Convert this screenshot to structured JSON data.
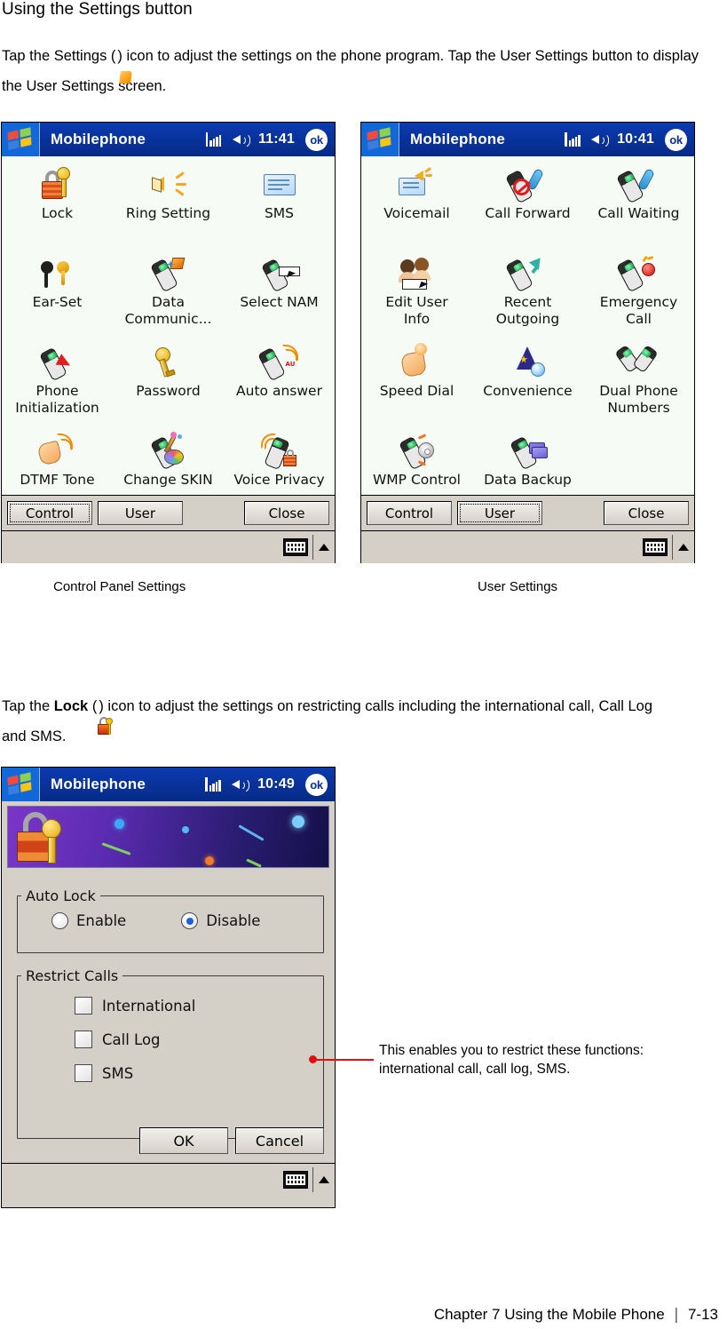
{
  "page": {
    "heading": "Using the Settings button",
    "intro_prefix": "Tap the Settings (",
    "intro_suffix": ") icon to adjust the settings on the phone program. Tap the User Settings button to display the User Settings screen.",
    "lock_prefix": "Tap the ",
    "lock_bold": "Lock",
    "lock_paren_open": " (",
    "lock_suffix": ") icon to adjust the settings on restricting calls including the international call, Call Log and SMS.",
    "footer_chapter": "Chapter 7 Using the Mobile Phone",
    "footer_separator": "❘",
    "footer_page": "7-13"
  },
  "captions": {
    "control": "Control Panel Settings",
    "user": "User Settings"
  },
  "device_control": {
    "titlebar": {
      "app_title": "Mobilephone",
      "clock": "11:41",
      "ok_label": "ok",
      "signal_icon": "signal-bars-icon",
      "speaker_icon": "speaker-volume-icon",
      "logo_icon": "windows-start-icon"
    },
    "icons": [
      {
        "label": "Lock",
        "glyph": "padlock-key-icon"
      },
      {
        "label": "Ring Setting",
        "glyph": "speaker-ring-icon"
      },
      {
        "label": "SMS",
        "glyph": "envelope-icon"
      },
      {
        "label": "Ear-Set",
        "glyph": "earset-icon"
      },
      {
        "label": "Data\nCommunic...",
        "glyph": "phone-data-icon"
      },
      {
        "label": "Select NAM",
        "glyph": "phone-select-icon"
      },
      {
        "label": "Phone\nInitialization",
        "glyph": "phone-init-icon"
      },
      {
        "label": "Password",
        "glyph": "key-icon"
      },
      {
        "label": "Auto answer",
        "glyph": "phone-auto-answer-icon"
      },
      {
        "label": "DTMF Tone",
        "glyph": "hand-tone-icon"
      },
      {
        "label": "Change SKIN",
        "glyph": "phone-skin-icon"
      },
      {
        "label": "Voice Privacy",
        "glyph": "phone-privacy-icon"
      }
    ],
    "buttons": {
      "control": "Control",
      "user": "User",
      "close": "Close",
      "focused": "Control"
    },
    "taskbar": {
      "keyboard_icon": "soft-keyboard-icon",
      "caret_icon": "caret-up-icon"
    }
  },
  "device_user": {
    "titlebar": {
      "app_title": "Mobilephone",
      "clock": "10:41",
      "ok_label": "ok",
      "signal_icon": "signal-bars-icon",
      "speaker_icon": "speaker-volume-icon",
      "logo_icon": "windows-start-icon"
    },
    "icons": [
      {
        "label": "Voicemail",
        "glyph": "voicemail-icon"
      },
      {
        "label": "Call Forward",
        "glyph": "call-forward-icon"
      },
      {
        "label": "Call Waiting",
        "glyph": "call-waiting-icon"
      },
      {
        "label": "Edit User\nInfo",
        "glyph": "edit-user-info-icon"
      },
      {
        "label": "Recent\nOutgoing",
        "glyph": "recent-outgoing-icon"
      },
      {
        "label": "Emergency\nCall",
        "glyph": "emergency-call-icon"
      },
      {
        "label": "Speed Dial",
        "glyph": "speed-dial-icon"
      },
      {
        "label": "Convenience",
        "glyph": "convenience-wizard-icon"
      },
      {
        "label": "Dual Phone\nNumbers",
        "glyph": "dual-phone-numbers-icon"
      },
      {
        "label": "WMP Control",
        "glyph": "wmp-control-icon"
      },
      {
        "label": "Data Backup",
        "glyph": "data-backup-icon"
      }
    ],
    "buttons": {
      "control": "Control",
      "user": "User",
      "close": "Close",
      "focused": "User"
    },
    "taskbar": {
      "keyboard_icon": "soft-keyboard-icon",
      "caret_icon": "caret-up-icon"
    }
  },
  "device_lock": {
    "titlebar": {
      "app_title": "Mobilephone",
      "clock": "10:49",
      "ok_label": "ok",
      "signal_icon": "signal-bars-icon",
      "speaker_icon": "speaker-volume-icon",
      "logo_icon": "windows-start-icon"
    },
    "banner": {
      "icon": "padlock-key-banner-icon"
    },
    "auto_lock": {
      "legend": "Auto Lock",
      "options": [
        {
          "label": "Enable",
          "selected": false
        },
        {
          "label": "Disable",
          "selected": true
        }
      ]
    },
    "restrict_calls": {
      "legend": "Restrict Calls",
      "options": [
        {
          "label": "International",
          "checked": false
        },
        {
          "label": "Call Log",
          "checked": false
        },
        {
          "label": "SMS",
          "checked": false
        }
      ]
    },
    "buttons": {
      "ok": "OK",
      "cancel": "Cancel"
    },
    "taskbar": {
      "keyboard_icon": "soft-keyboard-icon",
      "caret_icon": "caret-up-icon"
    }
  },
  "callout": {
    "text": "This enables you to restrict these functions: international call, call log, SMS."
  },
  "colors": {
    "titlebar_blue": "#08309c",
    "screen_bg": "#f7fbf6",
    "chrome_gray": "#d4d0c8",
    "callout_red": "#e01010"
  }
}
